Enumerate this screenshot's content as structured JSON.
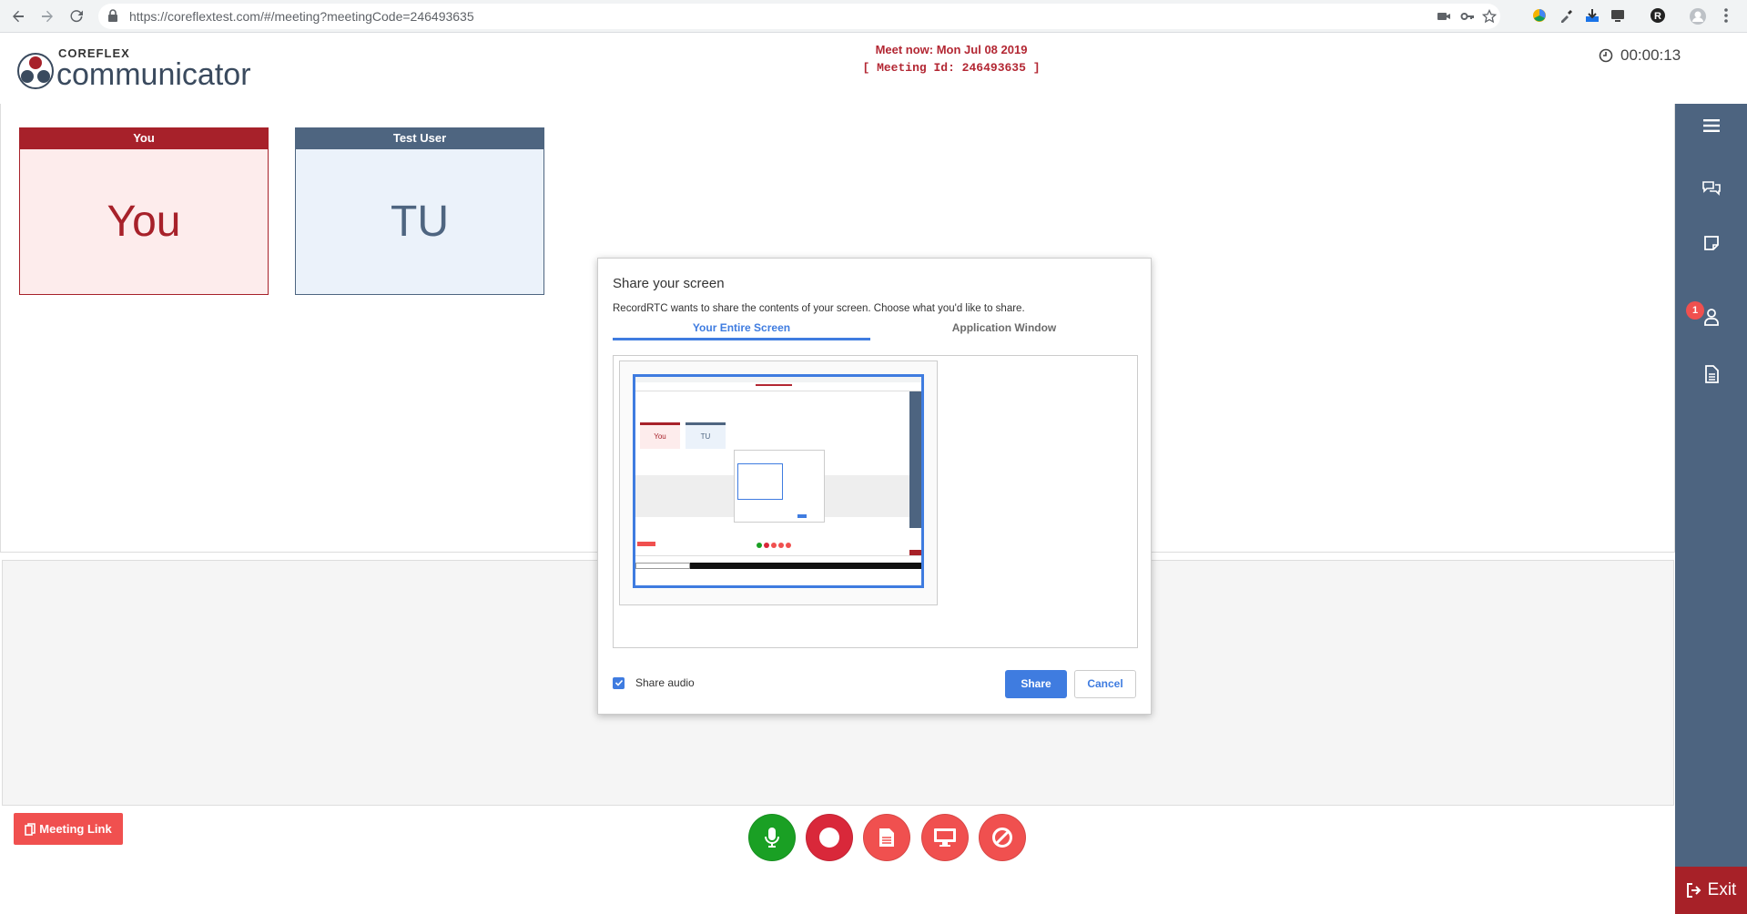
{
  "browser": {
    "url": "https://coreflextest.com/#/meeting?meetingCode=246493635"
  },
  "header": {
    "logo_top": "COREFLEX",
    "logo_main": "communicator",
    "meet_now": "Meet now: Mon Jul 08 2019",
    "meeting_id": "[ Meeting Id: 246493635 ]",
    "timer": "00:00:13"
  },
  "participants": [
    {
      "name": "You",
      "initials": "You"
    },
    {
      "name": "Test User",
      "initials": "TU"
    }
  ],
  "sidebar": {
    "badge_count": "1",
    "items": [
      "menu-icon",
      "chat-icon",
      "note-icon",
      "participants-icon",
      "document-icon"
    ],
    "exit_label": "Exit"
  },
  "controls": {
    "meeting_link_label": "Meeting Link",
    "buttons": [
      "microphone",
      "record",
      "file",
      "screen-share",
      "stop"
    ]
  },
  "dialog": {
    "title": "Share your screen",
    "description": "RecordRTC wants to share the contents of your screen. Choose what you'd like to share.",
    "tab_screen": "Your Entire Screen",
    "tab_window": "Application Window",
    "share_audio_label": "Share audio",
    "share_audio_checked": true,
    "share_label": "Share",
    "cancel_label": "Cancel"
  },
  "thumbnail": {
    "tile_you": "You",
    "tile_tu": "TU"
  },
  "colors": {
    "brand_red": "#a7212a",
    "brand_slate": "#4d6480",
    "accent_blue": "#3f7ce0",
    "mic_green": "#1aa024",
    "control_red": "#f0504f",
    "record_red": "#d9283a"
  }
}
